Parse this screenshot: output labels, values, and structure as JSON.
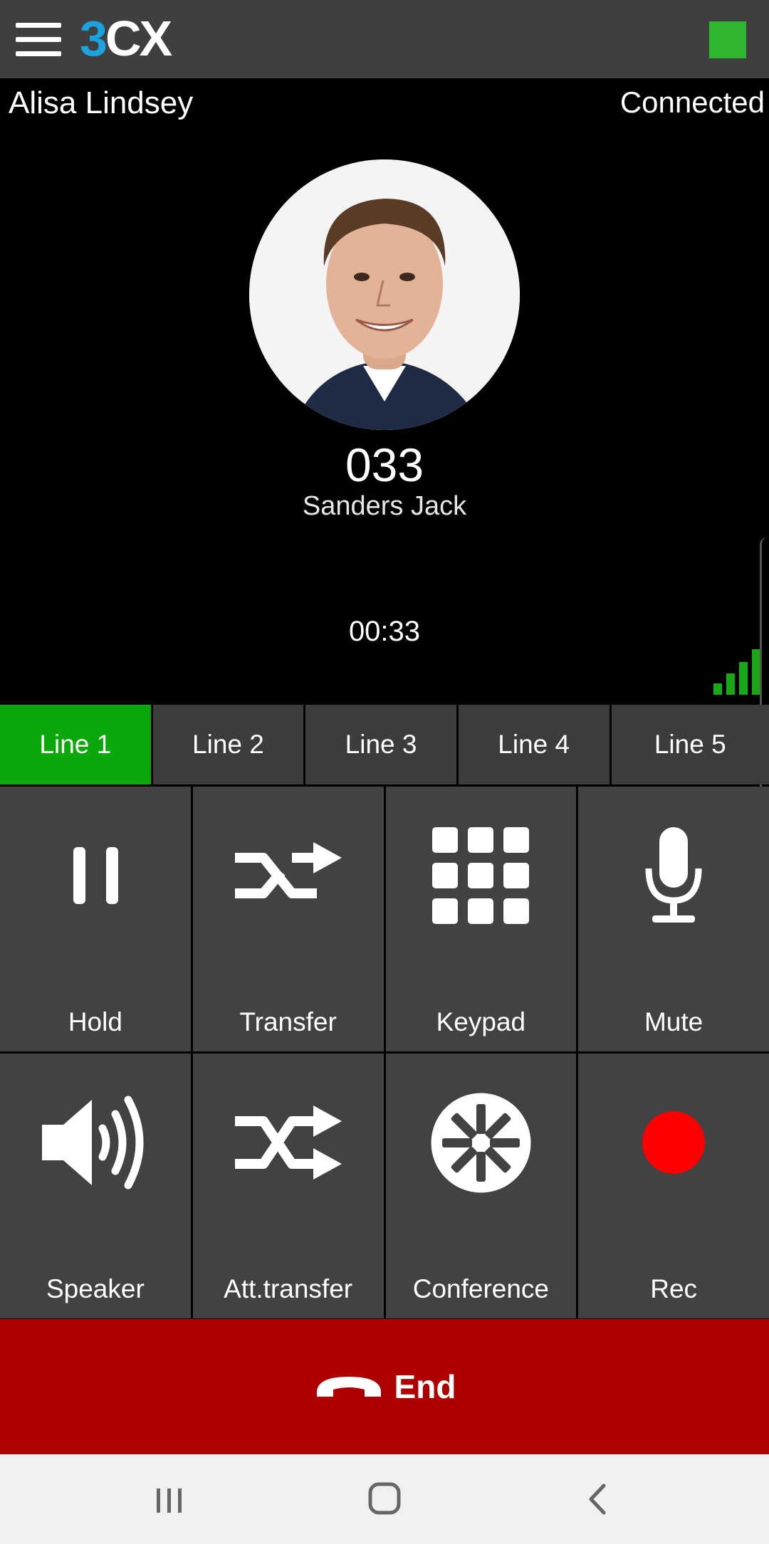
{
  "header": {
    "logo_text_3": "3",
    "logo_text_cx": "CX",
    "status_color": "#2fb52f"
  },
  "call": {
    "caller_name": "Alisa Lindsey",
    "status": "Connected",
    "extension": "033",
    "contact_name": "Sanders Jack",
    "duration": "00:33",
    "signal_bars": 4
  },
  "lines": [
    {
      "label": "Line 1",
      "active": true
    },
    {
      "label": "Line 2",
      "active": false
    },
    {
      "label": "Line 3",
      "active": false
    },
    {
      "label": "Line 4",
      "active": false
    },
    {
      "label": "Line 5",
      "active": false
    }
  ],
  "actions": [
    {
      "label": "Hold",
      "icon": "pause-icon"
    },
    {
      "label": "Transfer",
      "icon": "transfer-icon"
    },
    {
      "label": "Keypad",
      "icon": "keypad-icon"
    },
    {
      "label": "Mute",
      "icon": "microphone-icon"
    },
    {
      "label": "Speaker",
      "icon": "speaker-icon"
    },
    {
      "label": "Att.transfer",
      "icon": "attended-transfer-icon"
    },
    {
      "label": "Conference",
      "icon": "conference-icon"
    },
    {
      "label": "Rec",
      "icon": "record-icon"
    }
  ],
  "end_button": {
    "label": "End",
    "color": "#ae0000"
  },
  "colors": {
    "active_line": "#0aa80a",
    "record": "#ff0000",
    "brand": "#1aa3dd"
  }
}
